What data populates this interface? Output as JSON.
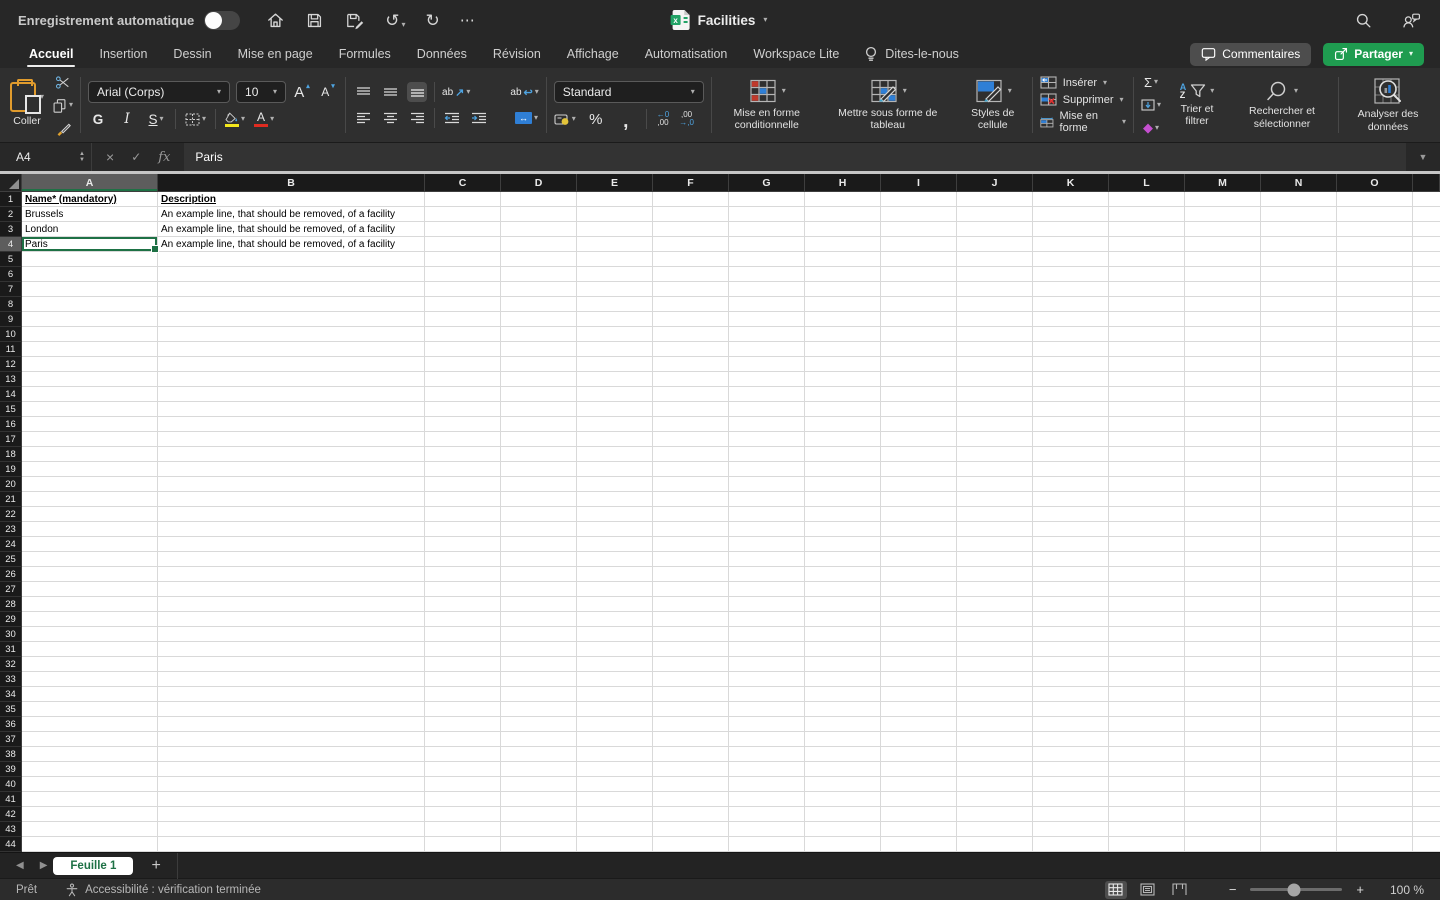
{
  "titlebar": {
    "autosave_label": "Enregistrement automatique",
    "doc_title": "Facilities"
  },
  "ribbon_tabs": {
    "items": [
      {
        "label": "Accueil"
      },
      {
        "label": "Insertion"
      },
      {
        "label": "Dessin"
      },
      {
        "label": "Mise en page"
      },
      {
        "label": "Formules"
      },
      {
        "label": "Données"
      },
      {
        "label": "Révision"
      },
      {
        "label": "Affichage"
      },
      {
        "label": "Automatisation"
      },
      {
        "label": "Workspace Lite"
      }
    ],
    "active_tab": "Accueil",
    "tell_us": "Dites-le-nous",
    "comments": "Commentaires",
    "share": "Partager"
  },
  "ribbon": {
    "paste": "Coller",
    "font_name": "Arial (Corps)",
    "font_size": "10",
    "bold": "G",
    "italic": "I",
    "underline": "S",
    "orientation": "ab",
    "wrap": "ab",
    "number_format": "Standard",
    "percent": "%",
    "comma": ",",
    "dec_add_top": "←0",
    "dec_add_bottom": ",00",
    "dec_rem_top": ",00",
    "dec_rem_bottom": "→,0",
    "conditional_formatting": "Mise en forme conditionnelle",
    "format_as_table": "Mettre sous forme de tableau",
    "cell_styles": "Styles de cellule",
    "insert": "Insérer",
    "delete": "Supprimer",
    "format": "Mise en forme",
    "autosum": "Σ",
    "sort_a": "A",
    "sort_z": "Z",
    "sort_filter": "Trier et filtrer",
    "find_select": "Rechercher et sélectionner",
    "analyze_data": "Analyser des données"
  },
  "formula_bar": {
    "cell_ref": "A4",
    "fx": "fx",
    "content": "Paris"
  },
  "grid": {
    "columns": [
      "A",
      "B",
      "C",
      "D",
      "E",
      "F",
      "G",
      "H",
      "I",
      "J",
      "K",
      "L",
      "M",
      "N",
      "O"
    ],
    "col_widths": {
      "A": 136,
      "B": 267,
      "default": 76
    },
    "row_count": 44,
    "selected_cell": {
      "col": "A",
      "row": 4
    },
    "cells": [
      {
        "col": "A",
        "row": 1,
        "text": "Name* (mandatory)",
        "header": true
      },
      {
        "col": "B",
        "row": 1,
        "text": "Description",
        "header": true
      },
      {
        "col": "A",
        "row": 2,
        "text": "Brussels"
      },
      {
        "col": "B",
        "row": 2,
        "text": "An example line, that should be removed, of a facility"
      },
      {
        "col": "A",
        "row": 3,
        "text": "London"
      },
      {
        "col": "B",
        "row": 3,
        "text": "An example line, that should be removed, of a facility"
      },
      {
        "col": "A",
        "row": 4,
        "text": "Paris"
      },
      {
        "col": "B",
        "row": 4,
        "text": "An example line, that should be removed, of a facility"
      }
    ]
  },
  "sheet_bar": {
    "tabs": [
      {
        "label": "Feuille 1",
        "active": true
      }
    ],
    "add_label": "+"
  },
  "status_bar": {
    "ready": "Prêt",
    "accessibility": "Accessibilité : vérification terminée",
    "zoom_level": "100 %"
  },
  "colors": {
    "share_green": "#1f9c50",
    "excel_selection_green": "#1e7145",
    "fill_yellow": "#f2e71c",
    "font_red": "#e02b20"
  }
}
